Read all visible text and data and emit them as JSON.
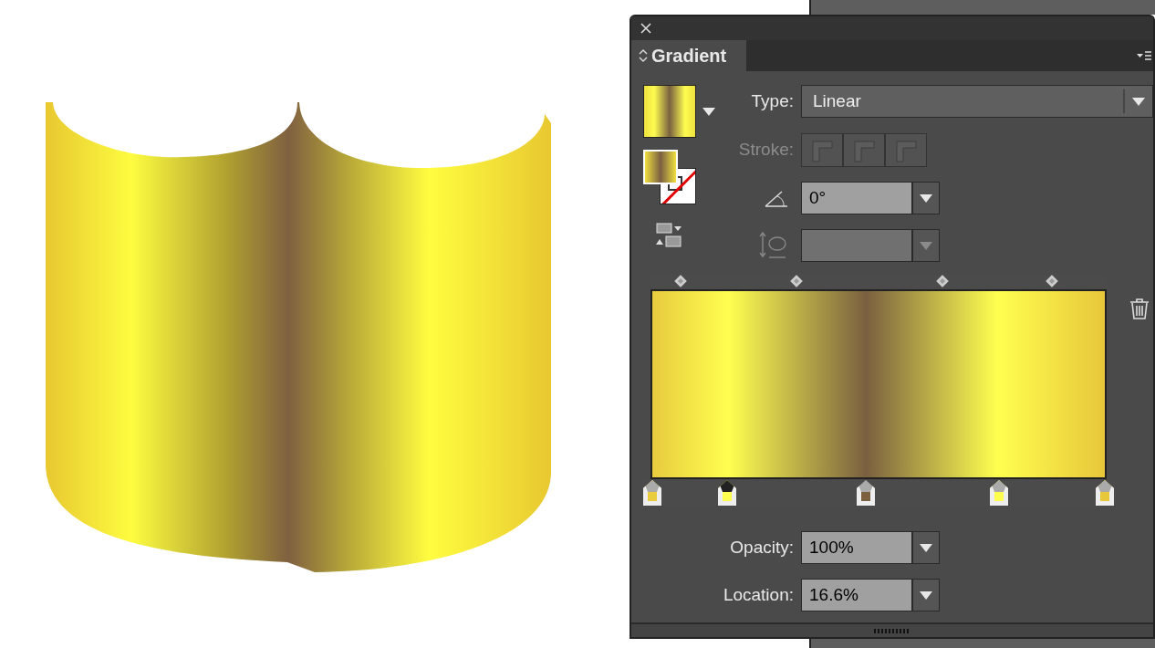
{
  "panel": {
    "title": "Gradient",
    "type": {
      "label": "Type:",
      "value": "Linear"
    },
    "stroke": {
      "label": "Stroke:",
      "disabled": true
    },
    "angle": {
      "value": "0°"
    },
    "aspect": {
      "disabled": true
    },
    "midpoints": [
      {
        "level": 0.066
      },
      {
        "level": 0.32
      },
      {
        "level": 0.64
      },
      {
        "level": 0.88
      }
    ],
    "stops": [
      {
        "level": 0.004,
        "color": "#e8cc3e",
        "selected": false
      },
      {
        "level": 0.168,
        "color": "#ffff50",
        "selected": true
      },
      {
        "level": 0.472,
        "color": "#7a6040",
        "selected": false
      },
      {
        "level": 0.764,
        "color": "#ffff50",
        "selected": false
      },
      {
        "level": 0.996,
        "color": "#e8c83a",
        "selected": false
      }
    ],
    "opacity": {
      "label": "Opacity:",
      "value": "100%"
    },
    "location": {
      "label": "Location:",
      "value": "16.6%"
    }
  }
}
